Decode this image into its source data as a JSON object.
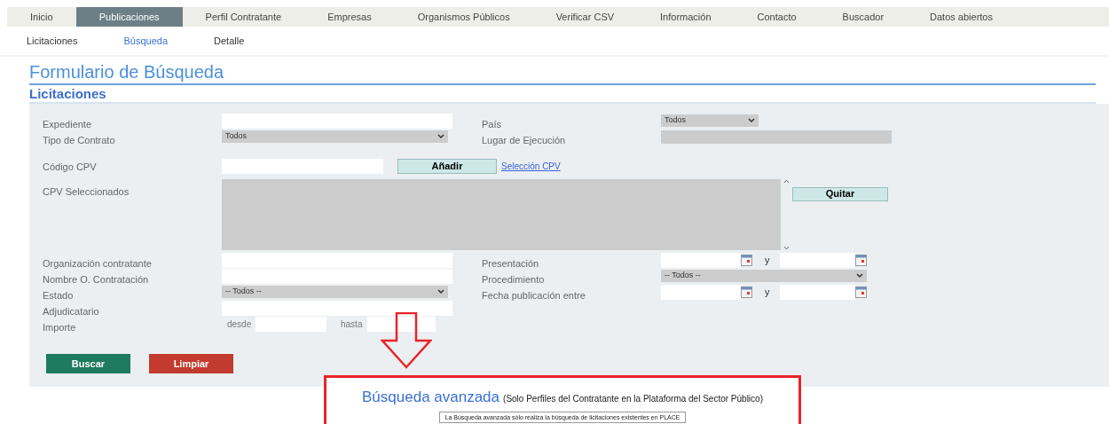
{
  "nav": [
    {
      "label": "Inicio",
      "selected": false
    },
    {
      "label": "Publicaciones",
      "selected": true
    },
    {
      "label": "Perfil Contratante",
      "selected": false
    },
    {
      "label": "Empresas",
      "selected": false
    },
    {
      "label": "Organismos Públicos",
      "selected": false
    },
    {
      "label": "Verificar CSV",
      "selected": false
    },
    {
      "label": "Información",
      "selected": false
    },
    {
      "label": "Contacto",
      "selected": false
    },
    {
      "label": "Buscador",
      "selected": false
    },
    {
      "label": "Datos abiertos",
      "selected": false
    }
  ],
  "subnav": [
    {
      "label": "Licitaciones",
      "selected": false
    },
    {
      "label": "Búsqueda",
      "selected": true
    },
    {
      "label": "Detalle",
      "selected": false
    }
  ],
  "title": "Formulario de Búsqueda",
  "section": "Licitaciones",
  "form": {
    "top_rows": [
      {
        "left": {
          "label": "Expediente",
          "kind": "text"
        },
        "right": {
          "label": "País",
          "kind": "short_select",
          "value": "Todos"
        }
      },
      {
        "left": {
          "label": "Tipo de Contrato",
          "kind": "select",
          "value": "Todos"
        },
        "right": {
          "label": "Lugar de Ejecución",
          "kind": "disabled"
        }
      }
    ],
    "cpv": {
      "label": "Código CPV",
      "add_button": "Añadir",
      "link": "Selección CPV",
      "selected_label": "CPV Seleccionados",
      "remove_button": "Quitar"
    },
    "bottom_rows": [
      {
        "left": {
          "label": "Organización contratante",
          "kind": "text"
        },
        "right": {
          "label": "Presentación",
          "kind": "daterange",
          "joiner": "y"
        }
      },
      {
        "left": {
          "label": "Nombre O. Contratación",
          "kind": "text"
        },
        "right": {
          "label": "Procedimiento",
          "kind": "select",
          "value": "-- Todos --"
        }
      },
      {
        "left": {
          "label": "Estado",
          "kind": "select",
          "value": "-- Todos --"
        },
        "right": {
          "label": "Fecha publicación entre",
          "kind": "daterange",
          "joiner": "y"
        }
      },
      {
        "left": {
          "label": "Adjudicatario",
          "kind": "text"
        }
      },
      {
        "left": {
          "label": "Importe",
          "kind": "range",
          "from": "desde",
          "to": "hasta"
        }
      }
    ],
    "buttons": [
      {
        "label": "Buscar",
        "kind": "primary"
      },
      {
        "label": "Limpiar",
        "kind": "danger"
      }
    ]
  },
  "callout": {
    "title": "Búsqueda avanzada",
    "subtitle": "(Solo Perfiles del Contratante en la Plataforma del Sector Público)",
    "notice": "La Búsqueda avanzada sólo realiza la búsqueda de licitaciones existentes en PLACE"
  }
}
